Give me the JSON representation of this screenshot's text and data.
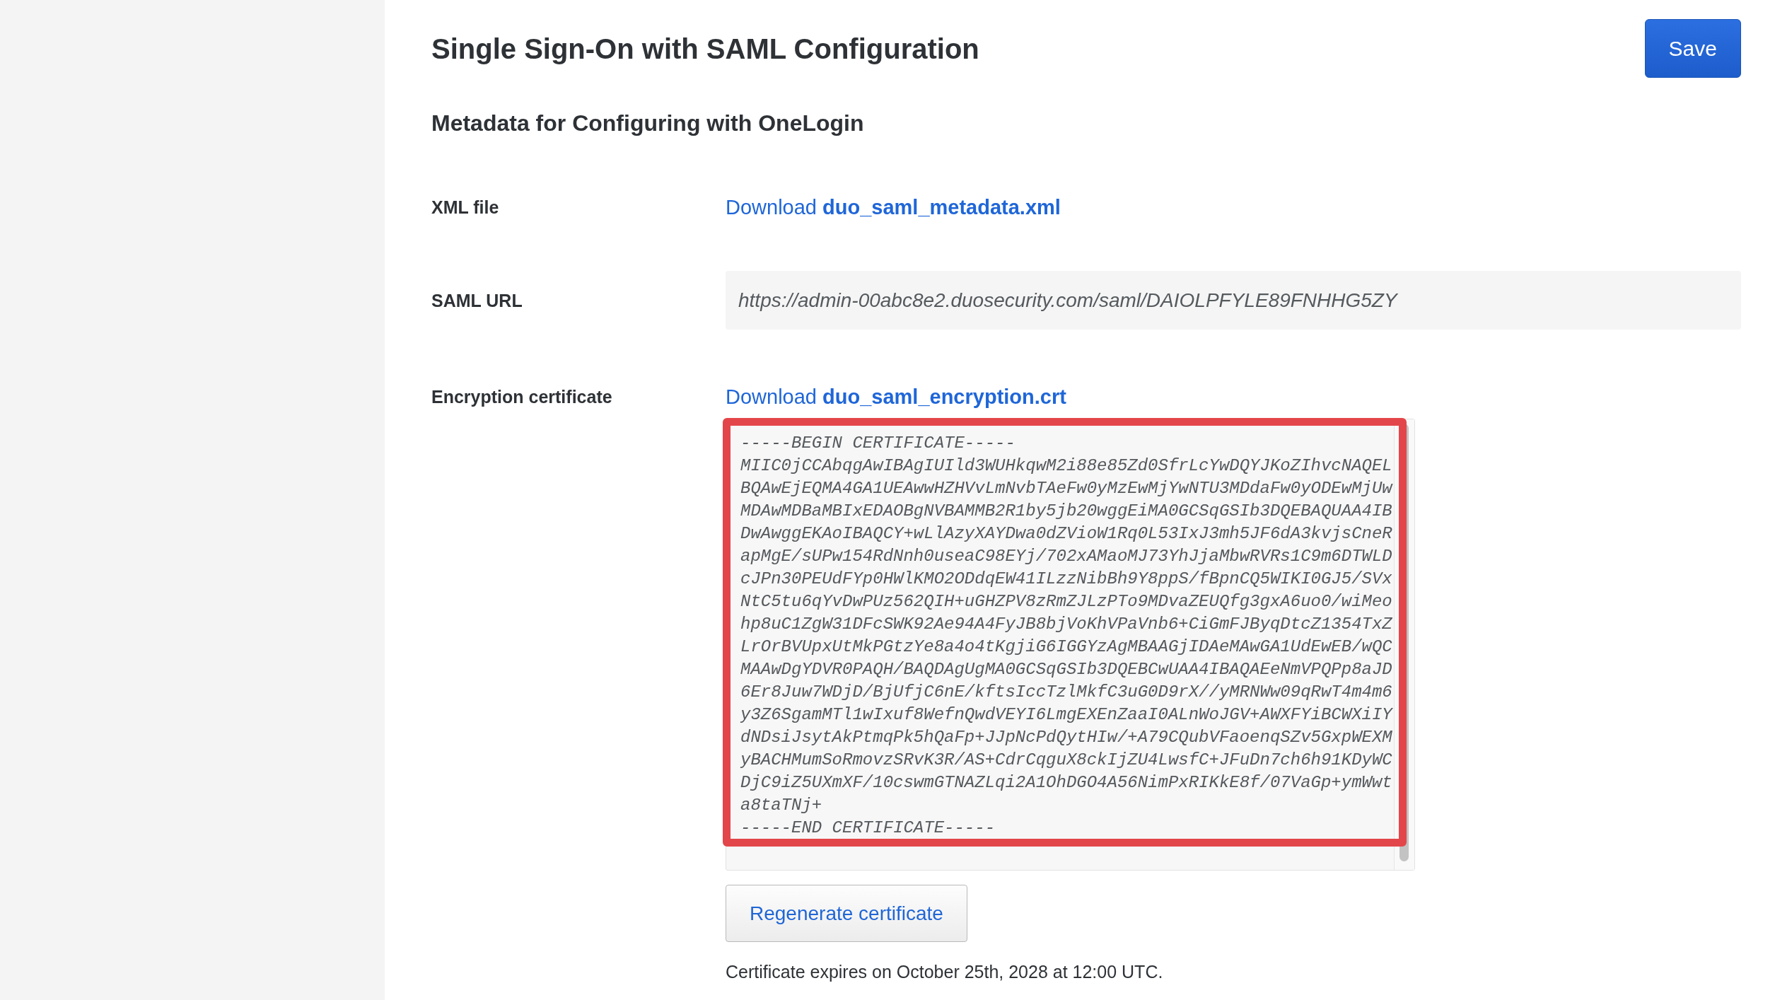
{
  "page": {
    "title": "Single Sign-On with SAML Configuration",
    "save_button": "Save"
  },
  "section": {
    "title": "Metadata for Configuring with OneLogin"
  },
  "fields": [
    {
      "kind": "download",
      "label": "XML file",
      "link": "Download **duo_saml_metadata.xml**"
    },
    {
      "kind": "text",
      "label": "SAML URL",
      "value": "https://admin-00abc8e2.duosecurity.com/saml/DAIOLPFYLE89FNHHG5ZY"
    },
    {
      "kind": "certificate",
      "label": "Encryption certificate",
      "link": "Download **duo_saml_encryption.crt**",
      "certificate_text": "-----BEGIN CERTIFICATE-----\nMIIC0jCCAbqgAwIBAgIUIld3WUHkqwM2i88e85Zd0SfrLcYwDQYJKoZIhvcNAQEL\nBQAwEjEQMA4GA1UEAwwHZHVvLmNvbTAeFw0yMzEwMjYwNTU3MDdaFw0yODEwMjUw\nMDAwMDBaMBIxEDAOBgNVBAMMB2R1by5jb20wggEiMA0GCSqGSIb3DQEBAQUAA4IB\nDwAwggEKAoIBAQCY+wLlAzyXAYDwa0dZVioW1Rq0L53IxJ3mh5JF6dA3kvjsCneR\napMgE/sUPw154RdNnh0useaC98EYj/702xAMaoMJ73YhJjaMbwRVRs1C9m6DTWLD\ncJPn30PEUdFYp0HWlKMO2ODdqEW41ILzzNibBh9Y8ppS/fBpnCQ5WIKI0GJ5/SVx\nNtC5tu6qYvDwPUz562QIH+uGHZPV8zRmZJLzPTo9MDvaZEUQfg3gxA6uo0/wiMeo\nhp8uC1ZgW31DFcSWK92Ae94A4FyJB8bjVoKhVPaVnb6+CiGmFJByqDtcZ1354TxZ\nLrOrBVUpxUtMkPGtzYe8a4o4tKgjiG6IGGYzAgMBAAGjIDAeMAwGA1UdEwEB/wQC\nMAAwDgYDVR0PAQH/BAQDAgUgMA0GCSqGSIb3DQEBCwUAA4IBAQAEeNmVPQPp8aJD\n6Er8Juw7WDjD/BjUfjC6nE/kftsIccTzlMkfC3uG0D9rX//yMRNWw09qRwT4m4m6\ny3Z6SgamMTl1wIxuf8WefnQwdVEYI6LmgEXEnZaaI0ALnWoJGV+AWXFYiBCWXiIY\ndNDsiJsytAkPtmqPk5hQaFp+JJpNcPdQytHIw/+A79CQubVFaoenqSZv5GxpWEXM\nyBACHMumSoRmovzSRvK3R/AS+CdrCqguX8ckIjZU4LwsfC+JFuDn7ch6h91KDyWC\nDjC9iZ5UXmXF/10cswmGTNAZLqi2A1OhDGO4A56NimPxRIKkE8f/07VaGp+ymWwt\na8taTNj+\n-----END CERTIFICATE-----",
      "highlighted": true,
      "button": "Regenerate certificate",
      "note": "Certificate expires on October 25th, 2028 at 12:00 UTC."
    }
  ]
}
